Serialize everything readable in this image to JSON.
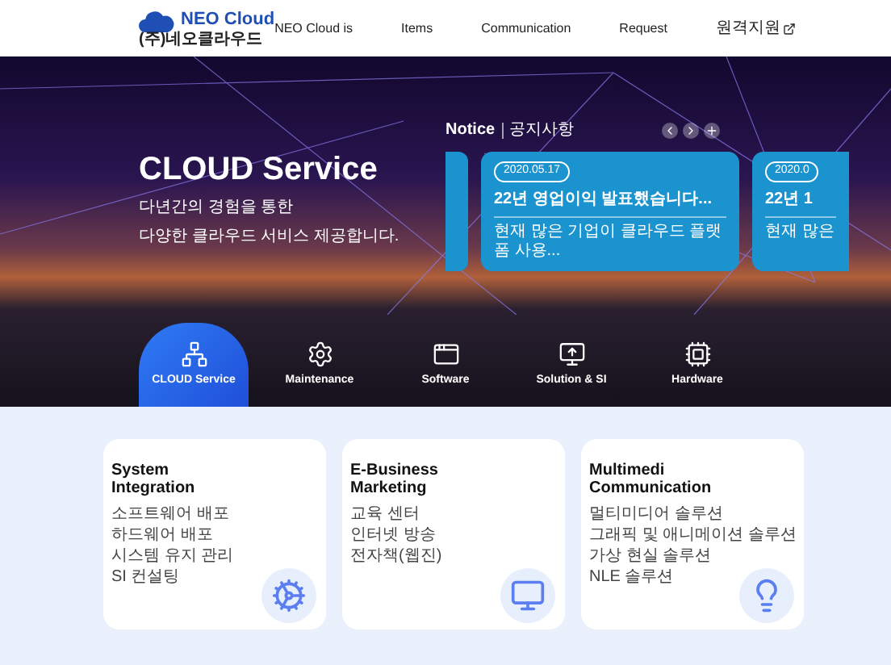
{
  "header": {
    "logo_name": "NEO Cloud",
    "logo_sub": "(주)네오클라우드",
    "nav": [
      {
        "label": "NEO Cloud is",
        "external": false
      },
      {
        "label": "Items",
        "external": false
      },
      {
        "label": "Communication",
        "external": false
      },
      {
        "label": "Request",
        "external": false
      },
      {
        "label": "원격지원",
        "external": true
      }
    ]
  },
  "hero": {
    "title": "CLOUD Service",
    "subtitle_lines": [
      "다년간의 경험을 통한",
      "다양한 클라우드 서비스 제공합니다."
    ]
  },
  "notice": {
    "title": "Notice",
    "subtitle": "공지사항",
    "cards": [
      {
        "kind": "edge"
      },
      {
        "kind": "full",
        "date": "2020.05.17",
        "title": "22년 영업이익 발표했습니다...",
        "text": "현재 많은 기업이 클라우드 플랫폼 사용..."
      },
      {
        "kind": "cut",
        "date": "2020.0",
        "title": "22년 1",
        "text": "현재 많은"
      }
    ]
  },
  "services": [
    {
      "label": "CLOUD Service",
      "kind": "cloud",
      "selected": true
    },
    {
      "label": "Maintenance",
      "kind": "gear",
      "selected": false
    },
    {
      "label": "Software",
      "kind": "window",
      "selected": false
    },
    {
      "label": "Solution & SI",
      "kind": "monitor",
      "selected": false
    },
    {
      "label": "Hardware",
      "kind": "chip",
      "selected": false
    }
  ],
  "cards": [
    {
      "title_lines": [
        "System",
        "Integration"
      ],
      "kind": "gear",
      "items": [
        "소프트웨어 배포",
        "하드웨어 배포",
        "시스템 유지 관리",
        "SI 컨설팅"
      ]
    },
    {
      "title_lines": [
        "E-Business",
        "Marketing"
      ],
      "kind": "monitor",
      "items": [
        "교육 센터",
        "인터넷 방송",
        "전자책(웹진)"
      ]
    },
    {
      "title_lines": [
        "Multimedi",
        "Communication"
      ],
      "kind": "bulb",
      "items": [
        "멀티미디어 솔루션",
        "그래픽 및 애니메이션 솔루션",
        "가상 현실 솔루션",
        "NLE 솔루션"
      ]
    }
  ]
}
